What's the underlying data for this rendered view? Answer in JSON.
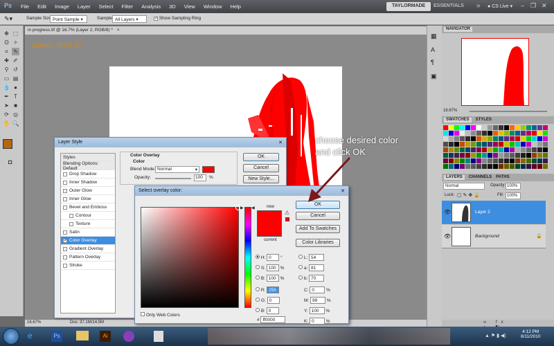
{
  "app": {
    "logo": "Ps",
    "menus": [
      "File",
      "Edit",
      "Image",
      "Layer",
      "Select",
      "Filter",
      "Analysis",
      "3D",
      "View",
      "Window",
      "Help"
    ],
    "workspace_active": "TAYLORMADE",
    "workspace_other": "ESSENTIALS",
    "cs_live": "CS Live"
  },
  "options_bar": {
    "sample_size_label": "Sample Size:",
    "sample_size_value": "Point Sample",
    "sample_label": "Sample:",
    "sample_value": "All Layers",
    "ring_label": "Show Sampling Ring"
  },
  "document": {
    "tab_title": "in progress.tif @ 16.7% (Layer 2, RGB/8) *",
    "watermark": "screen shot 37",
    "zoom": "16.67%",
    "doc_size": "Doc: 37.1M/14.5M"
  },
  "annotation": {
    "line1": "choose desired color",
    "line2": "and click OK"
  },
  "navigator": {
    "tab": "NAVIGATOR",
    "zoom": "16.67%"
  },
  "swatches": {
    "tabs": [
      "SWATCHES",
      "STYLES"
    ]
  },
  "layers_panel": {
    "tabs": [
      "LAYERS",
      "CHANNELS",
      "PATHS"
    ],
    "blend_mode": "Normal",
    "opacity_label": "Opacity:",
    "opacity_value": "100%",
    "lock_label": "Lock:",
    "fill_label": "Fill:",
    "fill_value": "100%",
    "layers": [
      {
        "name": "Layer 2"
      },
      {
        "name": "Background"
      }
    ]
  },
  "layer_style": {
    "title": "Layer Style",
    "list_header": "Styles",
    "items": [
      "Blending Options: Default",
      "Drop Shadow",
      "Inner Shadow",
      "Outer Glow",
      "Inner Glow",
      "Bevel and Emboss",
      "Contour",
      "Texture",
      "Satin",
      "Color Overlay",
      "Gradient Overlay",
      "Pattern Overlay",
      "Stroke"
    ],
    "section_title": "Color Overlay",
    "group_title": "Color",
    "blend_mode_label": "Blend Mode:",
    "blend_mode_value": "Normal",
    "opacity_label": "Opacity:",
    "opacity_value": "100",
    "opacity_unit": "%",
    "ok": "OK",
    "cancel": "Cancel",
    "new_style": "New Style...",
    "overlay_color": "#ff0000"
  },
  "color_picker": {
    "title": "Select overlay color:",
    "ok": "OK",
    "cancel": "Cancel",
    "add_to_swatches": "Add To Swatches",
    "color_libraries": "Color Libraries",
    "new_label": "new",
    "current_label": "current",
    "only_web": "Only Web Colors",
    "H": {
      "label": "H:",
      "value": "0",
      "unit": "°"
    },
    "S": {
      "label": "S:",
      "value": "100",
      "unit": "%"
    },
    "Bv": {
      "label": "B:",
      "value": "100",
      "unit": "%"
    },
    "R": {
      "label": "R:",
      "value": "255"
    },
    "G": {
      "label": "G:",
      "value": "0"
    },
    "Bc": {
      "label": "B:",
      "value": "0"
    },
    "L": {
      "label": "L:",
      "value": "54"
    },
    "a": {
      "label": "a:",
      "value": "81"
    },
    "b": {
      "label": "b:",
      "value": "70"
    },
    "C": {
      "label": "C:",
      "value": "0",
      "unit": "%"
    },
    "M": {
      "label": "M:",
      "value": "99",
      "unit": "%"
    },
    "Y": {
      "label": "Y:",
      "value": "100",
      "unit": "%"
    },
    "K": {
      "label": "K:",
      "value": "0",
      "unit": "%"
    },
    "hex_label": "#",
    "hex": "ff0000"
  },
  "taskbar": {
    "time": "4:12 PM",
    "date": "8/11/2010"
  }
}
